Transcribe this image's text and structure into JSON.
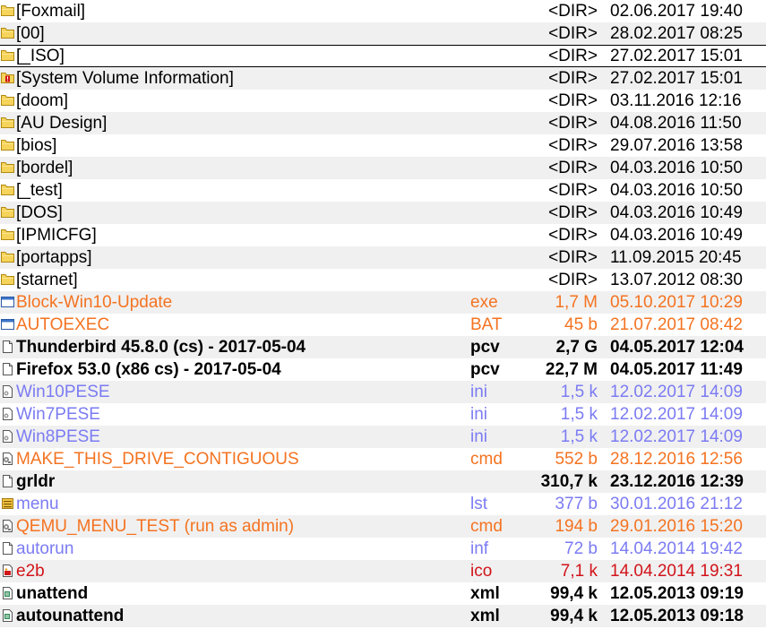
{
  "panel": {
    "rows": [
      {
        "name": "[Foxmail]",
        "ext": "",
        "size": "<DIR>",
        "date": "02.06.2017 19:40",
        "kind": "dir",
        "icon": "folder-icon"
      },
      {
        "name": "[00]",
        "ext": "",
        "size": "<DIR>",
        "date": "28.02.2017 08:25",
        "kind": "dir",
        "icon": "folder-icon"
      },
      {
        "name": "[_ISO]",
        "ext": "",
        "size": "<DIR>",
        "date": "27.02.2017 15:01",
        "kind": "dir",
        "icon": "folder-icon",
        "cursor": true
      },
      {
        "name": "[System Volume Information]",
        "ext": "",
        "size": "<DIR>",
        "date": "27.02.2017 15:01",
        "kind": "dir",
        "icon": "system-folder-icon"
      },
      {
        "name": "[doom]",
        "ext": "",
        "size": "<DIR>",
        "date": "03.11.2016 12:16",
        "kind": "dir",
        "icon": "folder-icon"
      },
      {
        "name": "[AU Design]",
        "ext": "",
        "size": "<DIR>",
        "date": "04.08.2016 11:50",
        "kind": "dir",
        "icon": "folder-icon"
      },
      {
        "name": "[bios]",
        "ext": "",
        "size": "<DIR>",
        "date": "29.07.2016 13:58",
        "kind": "dir",
        "icon": "folder-icon"
      },
      {
        "name": "[bordel]",
        "ext": "",
        "size": "<DIR>",
        "date": "04.03.2016 10:50",
        "kind": "dir",
        "icon": "folder-icon"
      },
      {
        "name": "[_test]",
        "ext": "",
        "size": "<DIR>",
        "date": "04.03.2016 10:50",
        "kind": "dir",
        "icon": "folder-icon"
      },
      {
        "name": "[DOS]",
        "ext": "",
        "size": "<DIR>",
        "date": "04.03.2016 10:49",
        "kind": "dir",
        "icon": "folder-icon"
      },
      {
        "name": "[IPMICFG]",
        "ext": "",
        "size": "<DIR>",
        "date": "04.03.2016 10:49",
        "kind": "dir",
        "icon": "folder-icon"
      },
      {
        "name": "[portapps]",
        "ext": "",
        "size": "<DIR>",
        "date": "11.09.2015 20:45",
        "kind": "dir",
        "icon": "folder-icon"
      },
      {
        "name": "[starnet]",
        "ext": "",
        "size": "<DIR>",
        "date": "13.07.2012 08:30",
        "kind": "dir",
        "icon": "folder-icon"
      },
      {
        "name": "Block-Win10-Update",
        "ext": "exe",
        "size": "1,7 M",
        "date": "05.10.2017 10:29",
        "kind": "orange",
        "icon": "application-icon"
      },
      {
        "name": "AUTOEXEC",
        "ext": "BAT",
        "size": "45 b",
        "date": "21.07.2017 08:42",
        "kind": "orange",
        "icon": "application-icon"
      },
      {
        "name": "Thunderbird 45.8.0 (cs) - 2017-05-04",
        "ext": "pcv",
        "size": "2,7 G",
        "date": "04.05.2017 12:04",
        "kind": "norm",
        "icon": "file-icon"
      },
      {
        "name": "Firefox 53.0 (x86 cs) - 2017-05-04",
        "ext": "pcv",
        "size": "22,7 M",
        "date": "04.05.2017 11:49",
        "kind": "norm",
        "icon": "file-icon"
      },
      {
        "name": "Win10PESE",
        "ext": "ini",
        "size": "1,5 k",
        "date": "12.02.2017 14:09",
        "kind": "blue",
        "icon": "settings-file-icon"
      },
      {
        "name": "Win7PESE",
        "ext": "ini",
        "size": "1,5 k",
        "date": "12.02.2017 14:09",
        "kind": "blue",
        "icon": "settings-file-icon"
      },
      {
        "name": "Win8PESE",
        "ext": "ini",
        "size": "1,5 k",
        "date": "12.02.2017 14:09",
        "kind": "blue",
        "icon": "settings-file-icon"
      },
      {
        "name": "MAKE_THIS_DRIVE_CONTIGUOUS",
        "ext": "cmd",
        "size": "552 b",
        "date": "28.12.2016 12:56",
        "kind": "orange",
        "icon": "script-file-icon"
      },
      {
        "name": "grldr",
        "ext": "",
        "size": "310,7 k",
        "date": "23.12.2016 12:39",
        "kind": "norm",
        "icon": "file-icon"
      },
      {
        "name": "menu",
        "ext": "lst",
        "size": "377 b",
        "date": "30.01.2016 21:12",
        "kind": "blue",
        "icon": "list-file-icon"
      },
      {
        "name": "QEMU_MENU_TEST (run as admin)",
        "ext": "cmd",
        "size": "194 b",
        "date": "29.01.2016 15:20",
        "kind": "orange",
        "icon": "script-file-icon"
      },
      {
        "name": "autorun",
        "ext": "inf",
        "size": "72 b",
        "date": "14.04.2014 19:42",
        "kind": "blue",
        "icon": "file-icon"
      },
      {
        "name": "e2b",
        "ext": "ico",
        "size": "7,1 k",
        "date": "14.04.2014 19:31",
        "kind": "red",
        "icon": "image-file-icon"
      },
      {
        "name": "unattend",
        "ext": "xml",
        "size": "99,4 k",
        "date": "12.05.2013 09:19",
        "kind": "norm",
        "icon": "xml-file-icon"
      },
      {
        "name": "autounattend",
        "ext": "xml",
        "size": "99,4 k",
        "date": "12.05.2013 09:18",
        "kind": "norm",
        "icon": "xml-file-icon"
      }
    ]
  },
  "colors": {
    "directory": "#000000",
    "executable": "#f47321",
    "config": "#7b7bf3",
    "image": "#d1141a",
    "alternate_row": "#f0f0f0"
  }
}
